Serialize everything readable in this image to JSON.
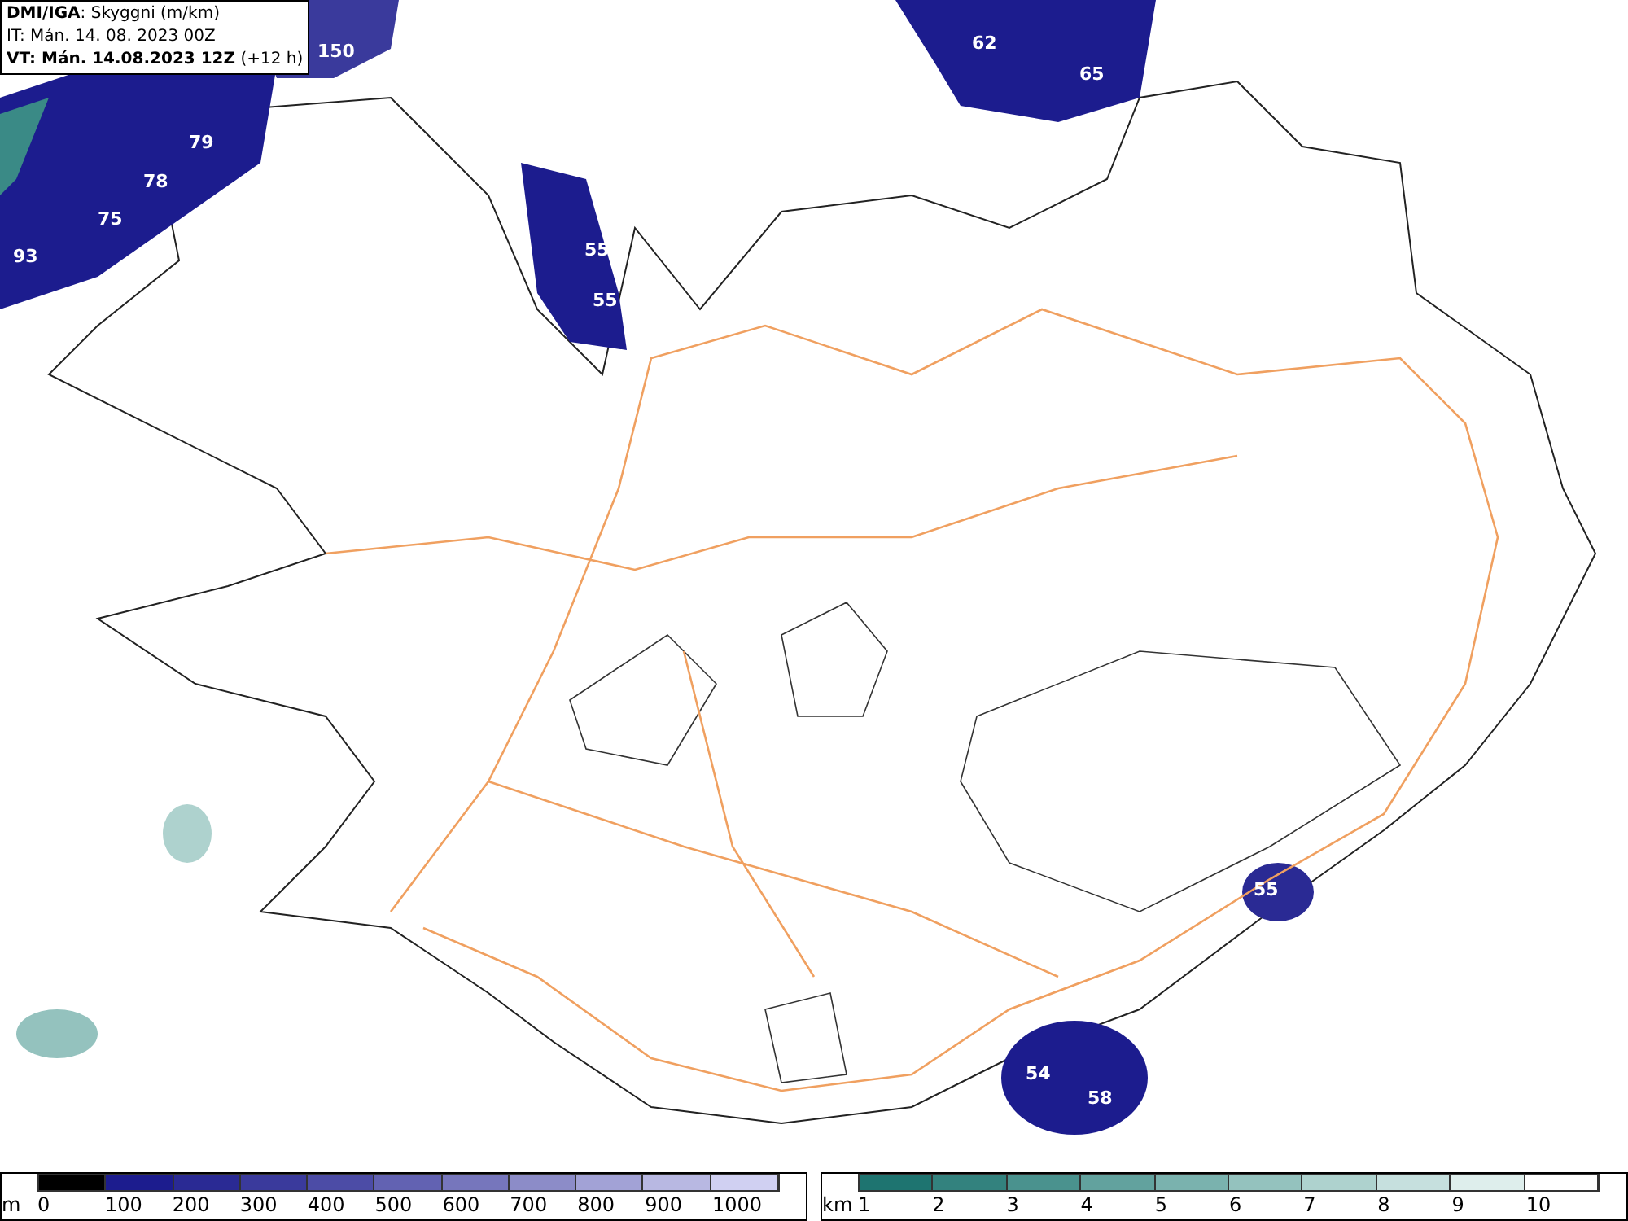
{
  "header": {
    "source": "DMI/IGA",
    "field": ": Skyggni (m/km)",
    "initial_time": "IT: Mán. 14. 08. 2023 00Z",
    "valid_time": "VT: Mán. 14.08.2023 12Z",
    "lead": "(+12 h)"
  },
  "map_labels": [
    "150",
    "62",
    "65",
    "79",
    "78",
    "75",
    "93",
    "55",
    "55",
    "55",
    "54",
    "58"
  ],
  "legends": [
    {
      "unit": "m",
      "items": [
        {
          "label": "0",
          "color": "#000000"
        },
        {
          "label": "100",
          "color": "#1c1c8e"
        },
        {
          "label": "200",
          "color": "#2a2a94"
        },
        {
          "label": "300",
          "color": "#3a3a9c"
        },
        {
          "label": "400",
          "color": "#4c4ca6"
        },
        {
          "label": "500",
          "color": "#6262b2"
        },
        {
          "label": "600",
          "color": "#7676bc"
        },
        {
          "label": "700",
          "color": "#8c8cc8"
        },
        {
          "label": "800",
          "color": "#a2a2d6"
        },
        {
          "label": "900",
          "color": "#b8b8e2"
        },
        {
          "label": "1000",
          "color": "#d0d0f2"
        }
      ]
    },
    {
      "unit": "km",
      "items": [
        {
          "label": "1",
          "color": "#1e7470"
        },
        {
          "label": "2",
          "color": "#33827e"
        },
        {
          "label": "3",
          "color": "#4a928e"
        },
        {
          "label": "4",
          "color": "#62a29e"
        },
        {
          "label": "5",
          "color": "#7ab2ae"
        },
        {
          "label": "6",
          "color": "#94c2be"
        },
        {
          "label": "7",
          "color": "#aed2ce"
        },
        {
          "label": "8",
          "color": "#c6e0de"
        },
        {
          "label": "9",
          "color": "#deeeec"
        },
        {
          "label": "10",
          "color": "#ffffff"
        }
      ]
    }
  ]
}
